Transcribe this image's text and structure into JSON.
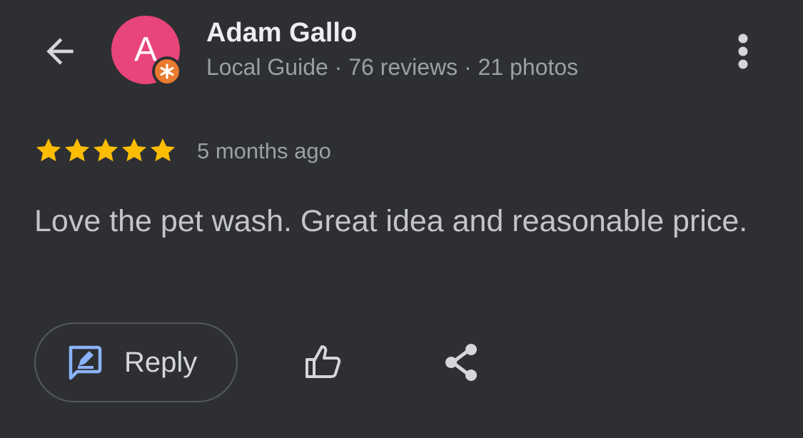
{
  "header": {
    "back_icon": "arrow-left-icon",
    "avatar_letter": "A",
    "avatar_color": "#e8457a",
    "badge_color": "#ea7a2f",
    "author_name": "Adam Gallo",
    "author_meta": "Local Guide · 76 reviews · 21 photos",
    "more_icon": "more-vertical-icon"
  },
  "review": {
    "rating": 5,
    "rating_max": 5,
    "star_color": "#fbbc04",
    "time": "5 months ago",
    "text": "Love the pet wash. Great idea and reasonable price."
  },
  "actions": {
    "reply_label": "Reply",
    "reply_icon": "reply-icon",
    "reply_icon_color": "#8ab4f8",
    "like_icon": "thumbs-up-icon",
    "share_icon": "share-icon"
  }
}
